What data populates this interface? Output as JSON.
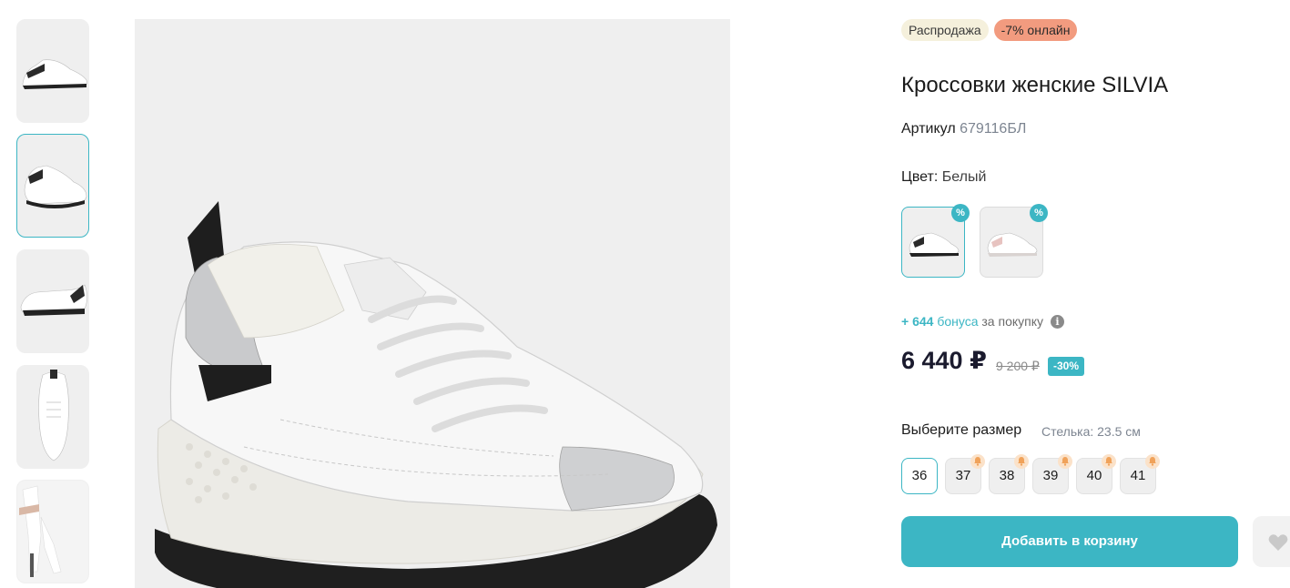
{
  "product": {
    "badges": [
      "Распродажа",
      "-7% онлайн"
    ],
    "title": "Кроссовки женские SILVIA",
    "sku_label": "Артикул",
    "sku_value": "679116БЛ",
    "color_label": "Цвет:",
    "color_value": "Белый",
    "color_options": [
      {
        "name": "white-silver-black",
        "badge": "%"
      },
      {
        "name": "white-pink-silver",
        "badge": "%"
      }
    ],
    "bonus": {
      "prefix": "+ ",
      "amount": "644",
      "word": " бонуса",
      "suffix": " за покупку"
    },
    "price": "6 440 ₽",
    "old_price": "9 200 ₽",
    "discount": "-30%",
    "size_label": "Выберите размер",
    "insole": "Стелька: 23.5 см",
    "sizes": [
      "36",
      "37",
      "38",
      "39",
      "40",
      "41"
    ],
    "add_to_cart": "Добавить в корзину"
  },
  "gallery": {
    "thumbnails": [
      "side-view",
      "three-quarter-view",
      "back-three-quarter-view",
      "top-view",
      "on-model-view"
    ],
    "active_index": 1
  },
  "colors": {
    "accent": "#3cb6c4",
    "sale_badge_bg": "#f5f0dc",
    "online_badge_bg": "#f29b7f",
    "thumb_bg": "#efefef"
  }
}
